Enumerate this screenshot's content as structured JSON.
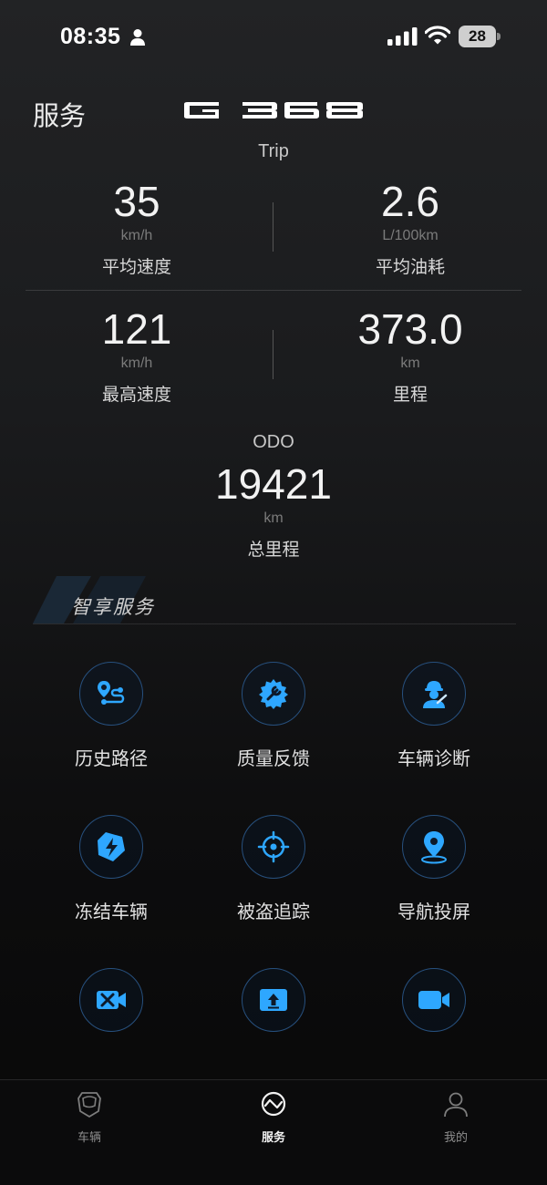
{
  "status_bar": {
    "time": "08:35",
    "battery": "28"
  },
  "header": {
    "title": "服务",
    "brand_logo_text": "G 368"
  },
  "trip": {
    "label": "Trip",
    "stats": [
      {
        "value": "35",
        "unit": "km/h",
        "label": "平均速度"
      },
      {
        "value": "2.6",
        "unit": "L/100km",
        "label": "平均油耗"
      },
      {
        "value": "121",
        "unit": "km/h",
        "label": "最高速度"
      },
      {
        "value": "373.0",
        "unit": "km",
        "label": "里程"
      }
    ]
  },
  "odo": {
    "label": "ODO",
    "value": "19421",
    "unit": "km",
    "caption": "总里程"
  },
  "smart_services": {
    "title": "智享服务",
    "items": [
      {
        "label": "历史路径",
        "icon": "route-pin-icon"
      },
      {
        "label": "质量反馈",
        "icon": "gear-wrench-icon"
      },
      {
        "label": "车辆诊断",
        "icon": "mechanic-icon"
      },
      {
        "label": "冻结车辆",
        "icon": "shield-bolt-icon"
      },
      {
        "label": "被盗追踪",
        "icon": "crosshair-icon"
      },
      {
        "label": "导航投屏",
        "icon": "location-pin-icon"
      },
      {
        "label": "",
        "icon": "video-tools-icon"
      },
      {
        "label": "",
        "icon": "screen-upload-icon"
      },
      {
        "label": "",
        "icon": "video-camera-icon"
      }
    ]
  },
  "tabbar": {
    "tabs": [
      {
        "label": "车辆",
        "icon": "car-icon",
        "active": false
      },
      {
        "label": "服务",
        "icon": "service-icon",
        "active": true
      },
      {
        "label": "我的",
        "icon": "user-icon",
        "active": false
      }
    ]
  },
  "colors": {
    "accent": "#2ea7ff",
    "ring": "#27507e",
    "background": "#1a1b1d"
  }
}
